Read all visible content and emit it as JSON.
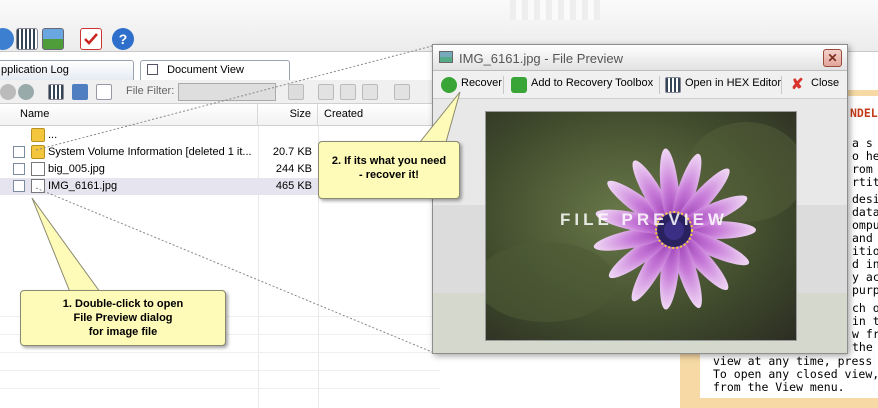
{
  "tabs": [
    {
      "label": "pplication Log"
    },
    {
      "label": "Document View"
    }
  ],
  "subtoolbar": {
    "filter_label": "File Filter:"
  },
  "columns": {
    "name": "Name",
    "size": "Size",
    "created": "Created"
  },
  "files": [
    {
      "name": "...",
      "size": "",
      "checkbox": false
    },
    {
      "name": "System Volume Information [deleted 1 it...",
      "size": "20.7 KB",
      "checkbox": true
    },
    {
      "name": "big_005.jpg",
      "size": "244 KB",
      "checkbox": true
    },
    {
      "name": "IMG_6161.jpg",
      "size": "465 KB",
      "checkbox": true
    }
  ],
  "preview": {
    "title": "IMG_6161.jpg - File Preview",
    "toolbar": {
      "recover": "Recover",
      "add_toolbox": "Add to Recovery Toolbox",
      "hex": "Open in HEX Editor",
      "close": "Close"
    },
    "watermark": "FILE PREVIEW"
  },
  "doc_lines": [
    "NDEL",
    "a  s",
    "o  he",
    "rom",
    "rtition",
    "desig",
    "data",
    "ompu",
    "and",
    "ition",
    "d  in",
    "y  ac",
    "purp",
    "ch  o",
    "in  tu",
    "w  fr",
    "the",
    "view at any time, press CT",
    "To open any closed view, s",
    "from the View menu."
  ],
  "callouts": {
    "step1": [
      "1. Double-click to open",
      "File Preview dialog",
      "for image file"
    ],
    "step2": [
      "2. If its what you need",
      "- recover it!"
    ]
  },
  "colors": {
    "callout_bg": "#fefab8",
    "accent_green": "#3aa537",
    "close_red": "#d9342b",
    "doc_orange": "#f6d9a5",
    "flower": "#b55bd0"
  }
}
